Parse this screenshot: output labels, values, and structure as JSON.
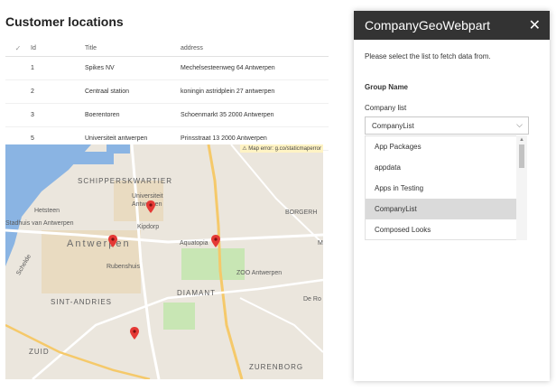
{
  "page": {
    "title": "Customer locations"
  },
  "table": {
    "columns": {
      "check": "✓",
      "id": "Id",
      "title": "Title",
      "address": "address"
    },
    "rows": [
      {
        "id": "1",
        "title": "Spikes NV",
        "address": "Mechelsesteenweg 64 Antwerpen"
      },
      {
        "id": "2",
        "title": "Centraal station",
        "address": "koningin astridplein 27 antwerpen"
      },
      {
        "id": "3",
        "title": "Boerentoren",
        "address": "Schoenmarkt 35 2000 Antwerpen"
      },
      {
        "id": "5",
        "title": "Universiteit antwerpen",
        "address": "Prinsstraat 13 2000 Antwerpen"
      }
    ]
  },
  "map": {
    "error": "⚠ Map error: g.co/staticmaperror",
    "labels": {
      "schipperskwartier": "SCHIPPERSKWARTIER",
      "universiteit": "Universiteit Antwerpen",
      "hetsteen": "Hetsteen",
      "stadhuis": "Stadhuis van Antwerpen",
      "antwerpen": "Antwerpen",
      "aquatopia": "Aquatopia",
      "rubenshuis": "Rubenshuis",
      "zoo": "ZOO Antwerpen",
      "diamant": "DIAMANT",
      "sint_andries": "SINT-ANDRIES",
      "zuid": "ZUID",
      "zurenborg": "ZURENBORG",
      "borgerhout": "BORGERH",
      "kipdorp": "Kipdorp",
      "scheldt": "Schelde",
      "de_ro": "De Ro",
      "m": "M"
    }
  },
  "panel": {
    "title": "CompanyGeoWebpart",
    "close": "✕",
    "description": "Please select the list to fetch data from.",
    "group_name": "Group Name",
    "field_label": "Company list",
    "dropdown_value": "CompanyList",
    "chevron": "⌵",
    "options": [
      "App Packages",
      "appdata",
      "Apps in Testing",
      "CompanyList",
      "Composed Looks"
    ],
    "selected_index": 3
  },
  "colors": {
    "header_bg": "#333333",
    "selected_option": "#dadada",
    "pin": "#e53935",
    "water": "#8ab4e3",
    "park": "#c8e6b4"
  }
}
